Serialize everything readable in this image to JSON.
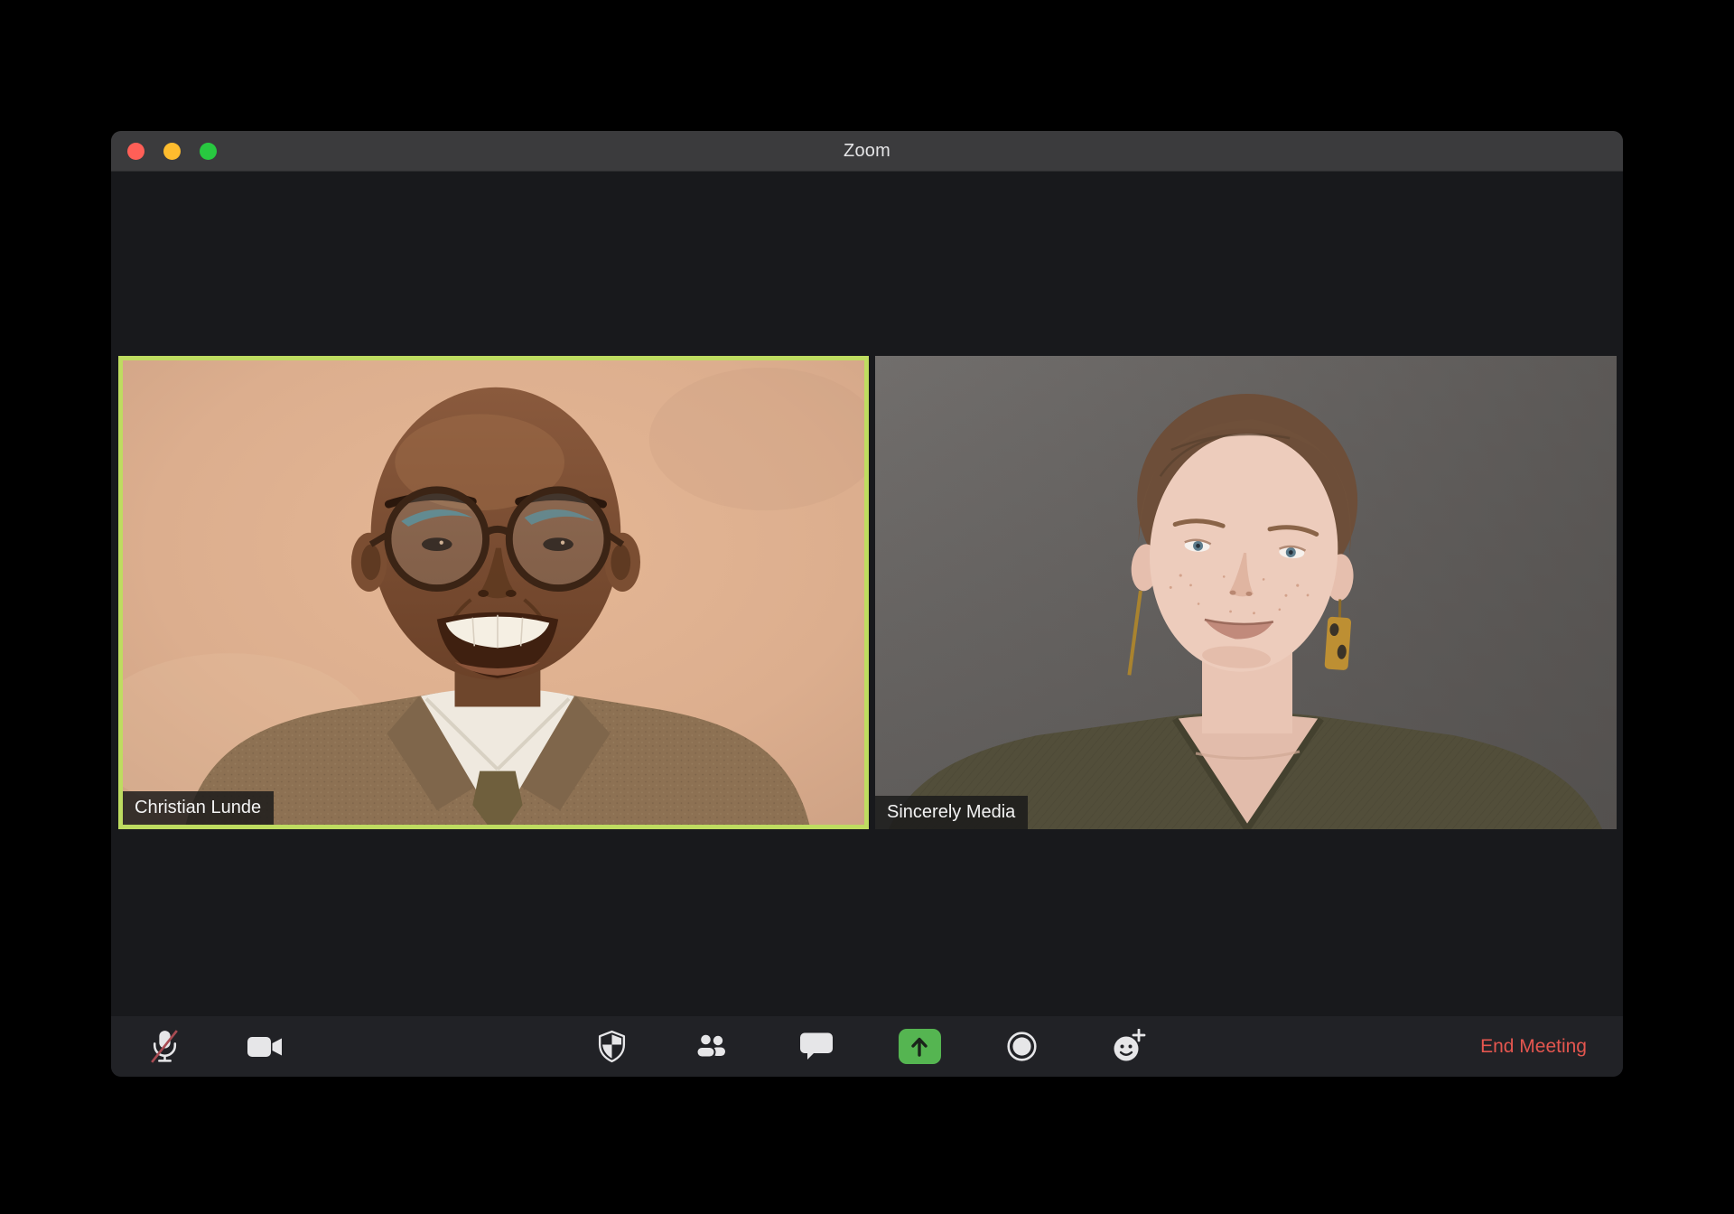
{
  "window": {
    "title": "Zoom",
    "controls": [
      {
        "id": "close",
        "label": "close"
      },
      {
        "id": "minimize",
        "label": "minimize"
      },
      {
        "id": "fullscreen",
        "label": "fullscreen"
      }
    ]
  },
  "meeting": {
    "participants": [
      {
        "name": "Christian Lunde",
        "active_speaker": true
      },
      {
        "name": "Sincerely Media",
        "active_speaker": false
      }
    ]
  },
  "toolbar": {
    "buttons": [
      {
        "id": "mute",
        "icon": "microphone-muted-icon",
        "state": "muted"
      },
      {
        "id": "video",
        "icon": "video-camera-icon",
        "state": "on"
      },
      {
        "id": "security",
        "icon": "shield-icon"
      },
      {
        "id": "participants",
        "icon": "participants-icon"
      },
      {
        "id": "chat",
        "icon": "chat-bubble-icon"
      },
      {
        "id": "share-screen",
        "icon": "share-screen-arrow-icon",
        "accent": true
      },
      {
        "id": "record",
        "icon": "record-icon"
      },
      {
        "id": "reactions",
        "icon": "smiley-plus-icon"
      }
    ],
    "end_meeting_label": "End Meeting"
  },
  "colors": {
    "traffic_red": "#ff5f57",
    "traffic_yellow": "#febc2e",
    "traffic_green": "#28c840",
    "share_green": "#55b551",
    "end_red": "#e4564f",
    "active_border": "#bedc60",
    "titlebar_bg": "#3b3b3d",
    "window_bg": "#18191c",
    "toolbar_bg": "#212226",
    "icon": "#e6e6e8"
  }
}
